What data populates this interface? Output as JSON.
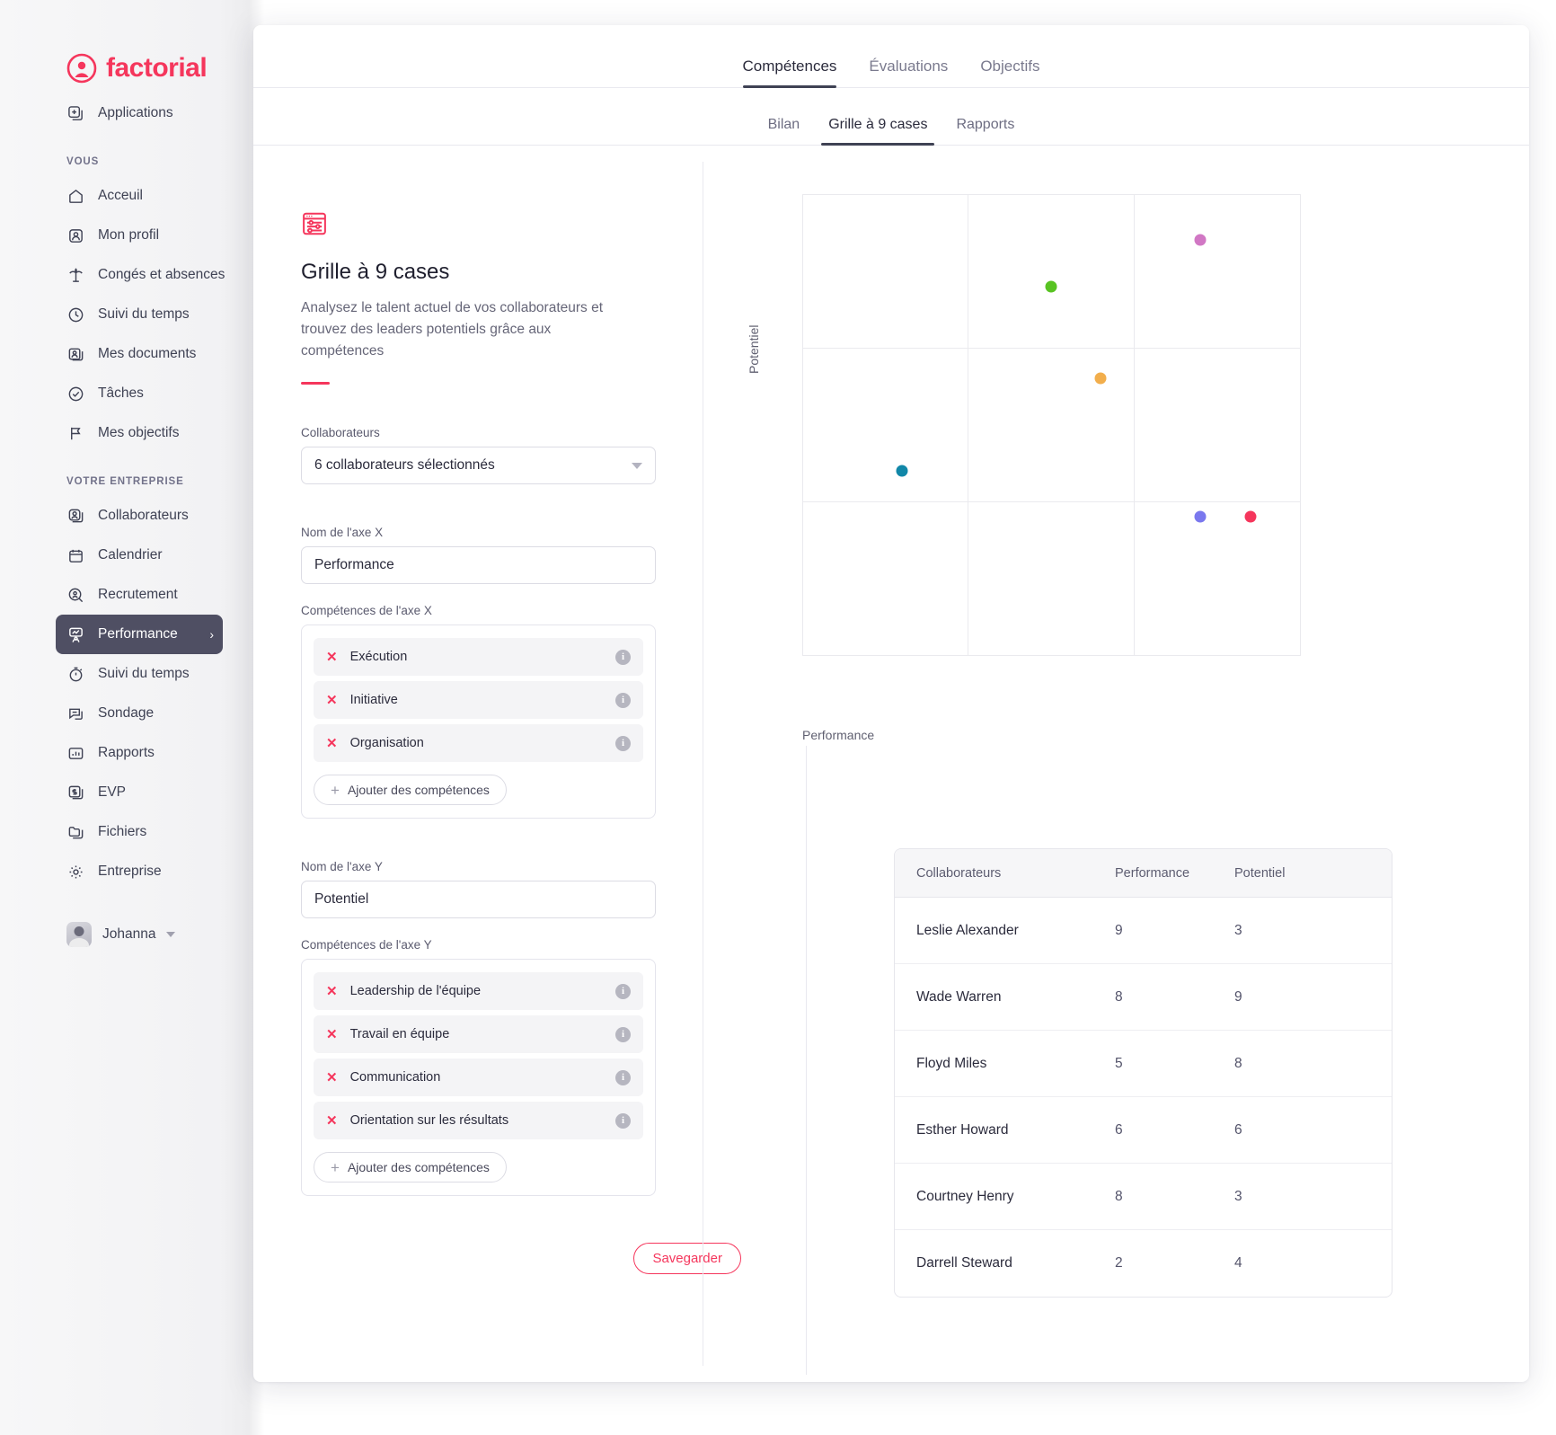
{
  "brand": {
    "name": "factorial",
    "color": "#f5365c"
  },
  "sidebar": {
    "applications": {
      "label": "Applications",
      "icon": "apps-icon"
    },
    "section_you": "VOUS",
    "you_items": [
      {
        "label": "Acceuil",
        "icon": "home-icon"
      },
      {
        "label": "Mon profil",
        "icon": "user-card-icon"
      },
      {
        "label": "Congés et absences",
        "icon": "palm-tree-icon"
      },
      {
        "label": "Suivi du temps",
        "icon": "clock-icon"
      },
      {
        "label": "Mes documents",
        "icon": "document-person-icon"
      },
      {
        "label": "Tâches",
        "icon": "check-circle-icon"
      },
      {
        "label": "Mes objectifs",
        "icon": "flag-icon"
      }
    ],
    "section_company": "VOTRE ENTREPRISE",
    "company_items": [
      {
        "label": "Collaborateurs",
        "icon": "people-icon"
      },
      {
        "label": "Calendrier",
        "icon": "calendar-icon"
      },
      {
        "label": "Recrutement",
        "icon": "recruit-icon"
      },
      {
        "label": "Performance",
        "icon": "performance-icon",
        "active": true,
        "chevron": "›"
      },
      {
        "label": "Suivi du temps",
        "icon": "stopwatch-icon"
      },
      {
        "label": "Sondage",
        "icon": "survey-icon"
      },
      {
        "label": "Rapports",
        "icon": "bar-chart-icon"
      },
      {
        "label": "EVP",
        "icon": "money-icon"
      },
      {
        "label": "Fichiers",
        "icon": "folder-icon"
      },
      {
        "label": "Entreprise",
        "icon": "gear-icon"
      }
    ],
    "user": {
      "name": "Johanna",
      "avatar": "avatar",
      "caret": "chevron-down-icon"
    }
  },
  "header": {
    "top_tabs": [
      {
        "label": "Compétences",
        "active": true
      },
      {
        "label": "Évaluations",
        "active": false
      },
      {
        "label": "Objectifs",
        "active": false
      }
    ],
    "sub_tabs": [
      {
        "label": "Bilan",
        "active": false
      },
      {
        "label": "Grille à 9 cases",
        "active": true
      },
      {
        "label": "Rapports",
        "active": false
      }
    ]
  },
  "panel": {
    "icon": "nine-box-grid-icon",
    "title": "Grille à 9 cases",
    "description": "Analysez le talent actuel de vos collaborateurs et trouvez des leaders potentiels grâce aux compétences",
    "collaborators_label": "Collaborateurs",
    "collaborators_value": "6 collaborateurs sélectionnés",
    "x_axis_name_label": "Nom de l'axe X",
    "x_axis_name_value": "Performance",
    "x_comp_label": "Compétences de l'axe X",
    "x_competences": [
      "Exécution",
      "Initiative",
      "Organisation"
    ],
    "y_axis_name_label": "Nom de l'axe Y",
    "y_axis_name_value": "Potentiel",
    "y_comp_label": "Compétences de l'axe Y",
    "y_competences": [
      "Leadership de l'équipe",
      "Travail en équipe",
      "Communication",
      "Orientation sur les résultats"
    ],
    "add_competences_label": "Ajouter des compétences",
    "save_label": "Savegarder",
    "remove_icon": "close-icon",
    "info_icon": "info-icon",
    "add_icon": "plus-icon"
  },
  "chart_data": {
    "type": "scatter",
    "title": "",
    "xlabel": "Performance",
    "ylabel": "Potentiel",
    "xlim": [
      0,
      10
    ],
    "ylim": [
      0,
      10
    ],
    "grid": true,
    "grid_rows": 3,
    "grid_cols": 3,
    "legend": "none",
    "points": [
      {
        "name": "Leslie Alexander",
        "x": 9,
        "y": 3,
        "color": "#f5365c"
      },
      {
        "name": "Wade Warren",
        "x": 8,
        "y": 9,
        "color": "#d177c4"
      },
      {
        "name": "Floyd Miles",
        "x": 5,
        "y": 8,
        "color": "#58c322"
      },
      {
        "name": "Esther Howard",
        "x": 6,
        "y": 6,
        "color": "#f2ae4c"
      },
      {
        "name": "Courtney Henry",
        "x": 8,
        "y": 3,
        "color": "#7a78ee"
      },
      {
        "name": "Darrell Steward",
        "x": 2,
        "y": 4,
        "color": "#1187a8"
      }
    ]
  },
  "table": {
    "columns": [
      "Collaborateurs",
      "Performance",
      "Potentiel"
    ],
    "rows": [
      {
        "name": "Leslie Alexander",
        "performance": "9",
        "potentiel": "3"
      },
      {
        "name": "Wade Warren",
        "performance": "8",
        "potentiel": "9"
      },
      {
        "name": "Floyd Miles",
        "performance": "5",
        "potentiel": "8"
      },
      {
        "name": "Esther Howard",
        "performance": "6",
        "potentiel": "6"
      },
      {
        "name": "Courtney Henry",
        "performance": "8",
        "potentiel": "3"
      },
      {
        "name": "Darrell Steward",
        "performance": "2",
        "potentiel": "4"
      }
    ]
  }
}
